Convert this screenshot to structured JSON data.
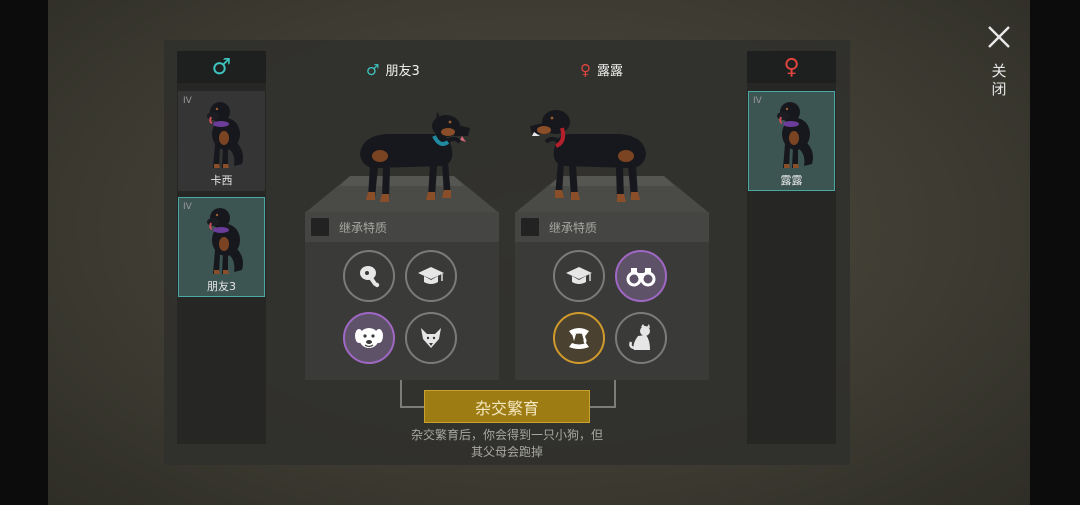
{
  "window": {
    "close_label": "关闭"
  },
  "male_column": {
    "symbol": "♂",
    "dogs": [
      {
        "name": "卡西",
        "grade": "IV",
        "selected": false
      },
      {
        "name": "朋友3",
        "grade": "IV",
        "selected": true
      }
    ]
  },
  "female_column": {
    "symbol": "♀",
    "dogs": [
      {
        "name": "露露",
        "grade": "IV",
        "selected": true
      }
    ]
  },
  "father": {
    "symbol": "♂",
    "name": "朋友3",
    "collar_color": "#1f8aa0",
    "inherit_label": "继承特质",
    "traits": [
      {
        "icon": "meat-icon",
        "style": "normal"
      },
      {
        "icon": "graduation-cap-icon",
        "style": "normal"
      },
      {
        "icon": "dog-face-icon",
        "style": "purple"
      },
      {
        "icon": "wolf-icon",
        "style": "normal"
      }
    ]
  },
  "mother": {
    "symbol": "♀",
    "name": "露露",
    "collar_color": "#b3202c",
    "inherit_label": "继承特质",
    "traits": [
      {
        "icon": "graduation-cap-icon",
        "style": "normal"
      },
      {
        "icon": "binoculars-icon",
        "style": "purple"
      },
      {
        "icon": "fangs-icon",
        "style": "gold"
      },
      {
        "icon": "sitting-cat-icon",
        "style": "normal"
      }
    ]
  },
  "breed": {
    "button_label": "杂交繁育",
    "note_line1": "杂交繁育后，你会得到一只小狗，但",
    "note_line2": "其父母会跑掉"
  },
  "colors": {
    "male": "#3ec6c0",
    "female": "#e2453f",
    "selected_card": "#3c5452",
    "button": "#9d7c14",
    "trait_purple": "#a068c4",
    "trait_gold": "#d19a2c"
  }
}
